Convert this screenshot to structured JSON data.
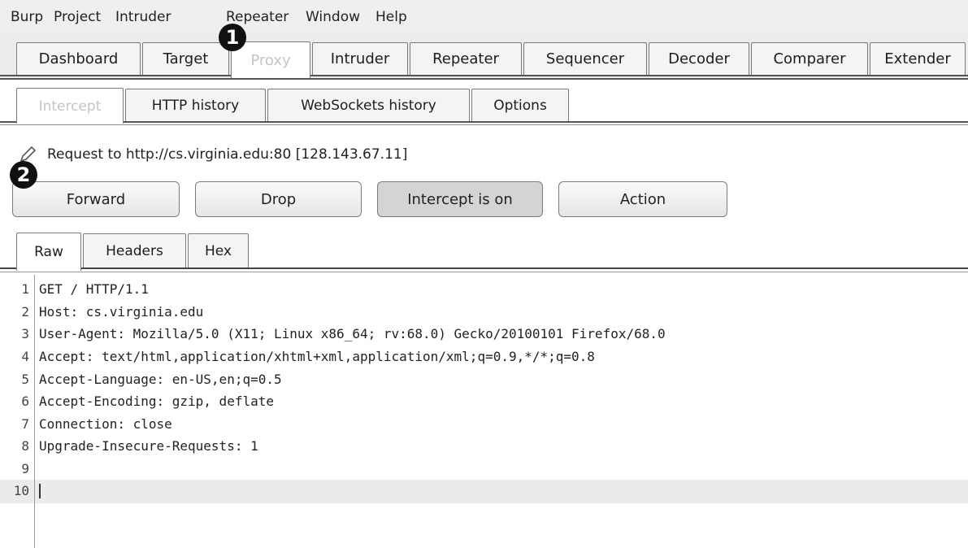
{
  "menubar": {
    "items": [
      "Burp",
      "Project",
      "Intruder",
      "Repeater",
      "Window",
      "Help"
    ]
  },
  "main_tabs": [
    "Dashboard",
    "Target",
    "Proxy",
    "Intruder",
    "Repeater",
    "Sequencer",
    "Decoder",
    "Comparer",
    "Extender"
  ],
  "proxy_tabs": [
    "Intercept",
    "HTTP history",
    "WebSockets history",
    "Options"
  ],
  "intercept": {
    "request_label": "Request to http://cs.virginia.edu:80  [128.143.67.11]",
    "buttons": {
      "forward": "Forward",
      "drop": "Drop",
      "intercept_toggle": "Intercept is on",
      "action": "Action"
    }
  },
  "view_tabs": [
    "Raw",
    "Headers",
    "Hex"
  ],
  "editor": {
    "lines": [
      {
        "n": "1",
        "text": "GET / HTTP/1.1"
      },
      {
        "n": "2",
        "text": "Host: cs.virginia.edu"
      },
      {
        "n": "3",
        "text": "User-Agent: Mozilla/5.0 (X11; Linux x86_64; rv:68.0) Gecko/20100101 Firefox/68.0"
      },
      {
        "n": "4",
        "text": "Accept: text/html,application/xhtml+xml,application/xml;q=0.9,*/*;q=0.8"
      },
      {
        "n": "5",
        "text": "Accept-Language: en-US,en;q=0.5"
      },
      {
        "n": "6",
        "text": "Accept-Encoding: gzip, deflate"
      },
      {
        "n": "7",
        "text": "Connection: close"
      },
      {
        "n": "8",
        "text": "Upgrade-Insecure-Requests: 1"
      },
      {
        "n": "9",
        "text": ""
      },
      {
        "n": "10",
        "text": ""
      }
    ]
  },
  "callouts": [
    "1",
    "2"
  ],
  "icons": {
    "pencil": "pencil-icon"
  }
}
